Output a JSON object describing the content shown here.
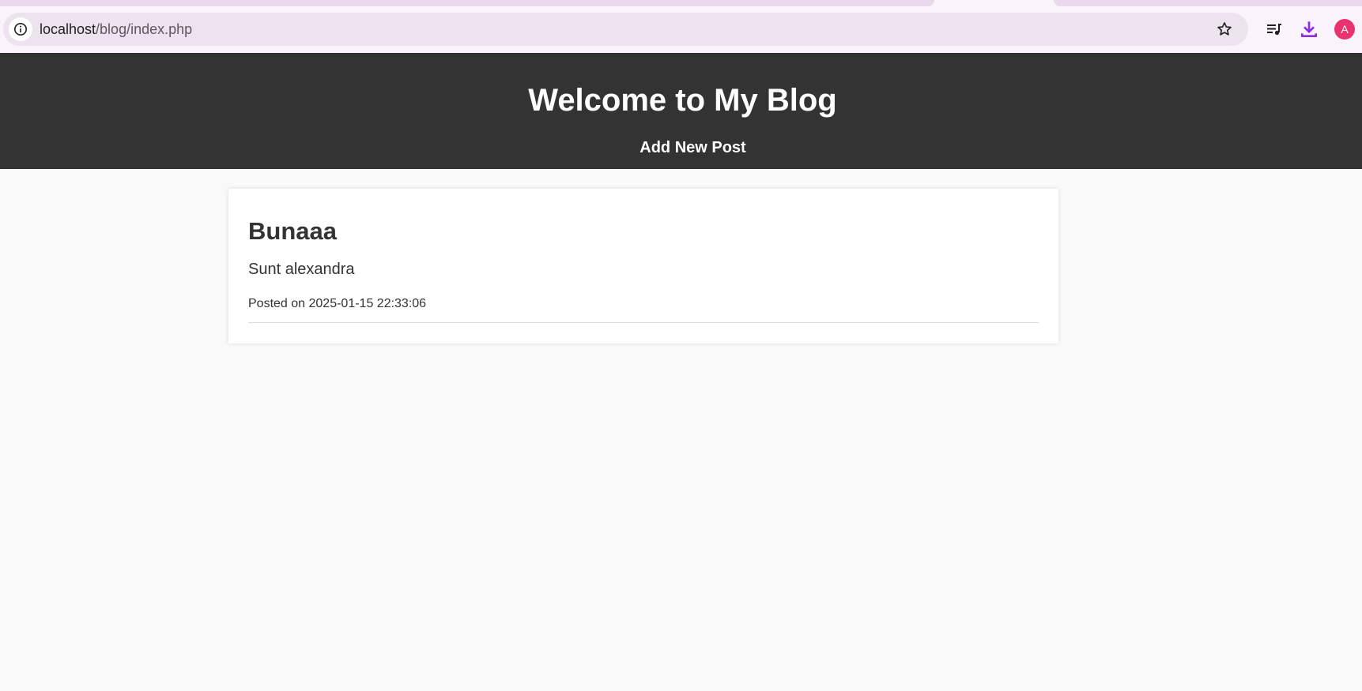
{
  "browser": {
    "url_host": "localhost",
    "url_path": "/blog/index.php",
    "icons": {
      "site_info": "info-icon",
      "bookmark": "star-icon",
      "media": "playlist-icon",
      "downloads": "download-icon"
    },
    "accent_color": "#8a2be2",
    "avatar_letter": "A",
    "avatar_color": "#e8336e"
  },
  "header": {
    "title": "Welcome to My Blog",
    "nav_link": "Add New Post",
    "background": "#333333"
  },
  "posts": [
    {
      "title": "Bunaaa",
      "content": "Sunt alexandra",
      "meta": "Posted on 2025-01-15 22:33:06"
    }
  ]
}
